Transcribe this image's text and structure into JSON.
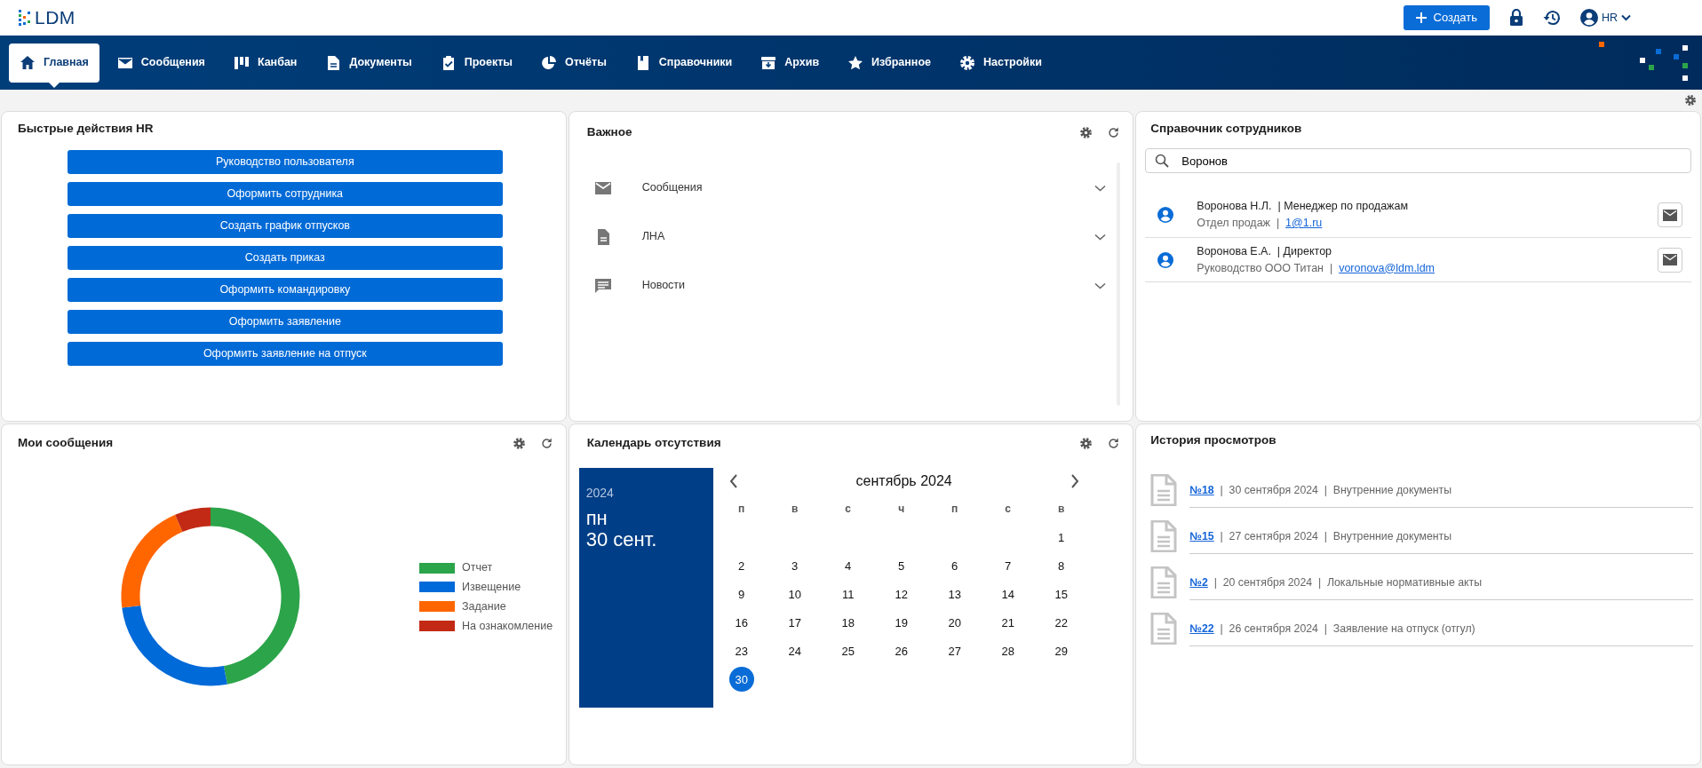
{
  "header": {
    "logo": "LDM",
    "create_button": "Создать",
    "user": "HR"
  },
  "nav": [
    {
      "label": "Главная",
      "selected": true
    },
    {
      "label": "Сообщения",
      "selected": false
    },
    {
      "label": "Канбан",
      "selected": false
    },
    {
      "label": "Документы",
      "selected": false
    },
    {
      "label": "Проекты",
      "selected": false
    },
    {
      "label": "Отчёты",
      "selected": false
    },
    {
      "label": "Справочники",
      "selected": false
    },
    {
      "label": "Архив",
      "selected": false
    },
    {
      "label": "Избранное",
      "selected": false
    },
    {
      "label": "Настройки",
      "selected": false
    }
  ],
  "quick_actions": {
    "title": "Быстрые действия HR",
    "buttons": [
      "Руководство пользователя",
      "Оформить сотрудника",
      "Создать график отпусков",
      "Создать приказ",
      "Оформить командировку",
      "Оформить заявление",
      "Оформить заявление на отпуск"
    ]
  },
  "important": {
    "title": "Важное",
    "items": [
      {
        "label": "Сообщения",
        "expanded": false
      },
      {
        "label": "ЛНА",
        "expanded": false
      },
      {
        "label": "Новости",
        "expanded": false
      }
    ]
  },
  "employee_directory": {
    "title": "Справочник сотрудников",
    "search": {
      "value": "Воронов"
    },
    "employees": [
      {
        "name": "Воронова Н.Л.  | Менеджер по продажам",
        "department": "Отдел продаж  |",
        "email": "1@1.ru"
      },
      {
        "name": "Воронова Е.А.  | Директор",
        "department": "Руководство ООО Титан  |",
        "email": "voronova@ldm.ldm"
      }
    ]
  },
  "my_messages": {
    "title": "Мои сообщения",
    "legend": [
      {
        "label": "Отчет",
        "color": "#2ca44a"
      },
      {
        "label": "Извещение",
        "color": "#006ad8"
      },
      {
        "label": "Задание",
        "color": "#ff6600"
      },
      {
        "label": "На ознакомление",
        "color": "#c22a15"
      }
    ]
  },
  "absence_calendar": {
    "title": "Календарь отсутствия",
    "year": "2024",
    "weekday": "пн",
    "date": "30 сент.",
    "month_title": "сентябрь 2024",
    "weekdays": [
      "п",
      "в",
      "с",
      "ч",
      "п",
      "с",
      "в"
    ],
    "weeks": [
      [
        {
          "day": "1",
          "selected": false
        }
      ],
      [
        {
          "day": "2",
          "selected": false
        },
        {
          "day": "3",
          "selected": false
        },
        {
          "day": "4",
          "selected": false
        },
        {
          "day": "5",
          "selected": false
        },
        {
          "day": "6",
          "selected": false
        },
        {
          "day": "7",
          "selected": false
        },
        {
          "day": "8",
          "selected": false
        }
      ],
      [
        {
          "day": "9",
          "selected": false
        },
        {
          "day": "10",
          "selected": false
        },
        {
          "day": "11",
          "selected": false
        },
        {
          "day": "12",
          "selected": false
        },
        {
          "day": "13",
          "selected": false
        },
        {
          "day": "14",
          "selected": false
        },
        {
          "day": "15",
          "selected": false
        }
      ],
      [
        {
          "day": "16",
          "selected": false
        },
        {
          "day": "17",
          "selected": false
        },
        {
          "day": "18",
          "selected": false
        },
        {
          "day": "19",
          "selected": false
        },
        {
          "day": "20",
          "selected": false
        },
        {
          "day": "21",
          "selected": false
        },
        {
          "day": "22",
          "selected": false
        }
      ],
      [
        {
          "day": "23",
          "selected": false
        },
        {
          "day": "24",
          "selected": false
        },
        {
          "day": "25",
          "selected": false
        },
        {
          "day": "26",
          "selected": false
        },
        {
          "day": "27",
          "selected": false
        },
        {
          "day": "28",
          "selected": false
        },
        {
          "day": "29",
          "selected": false
        }
      ],
      [
        {
          "day": "30",
          "selected": true
        }
      ]
    ]
  },
  "view_history": {
    "title": "История просмотров",
    "items": [
      {
        "number": "№18",
        "details": "|  30 сентября 2024  |  Внутренние документы"
      },
      {
        "number": "№15",
        "details": "|  27 сентября 2024  |  Внутренние документы"
      },
      {
        "number": "№2",
        "details": "|  20 сентября 2024  |  Локальные нормативные акты"
      },
      {
        "number": "№22",
        "details": "|  26 сентября 2024  |  Заявление на отпуск (отгул)"
      }
    ]
  }
}
